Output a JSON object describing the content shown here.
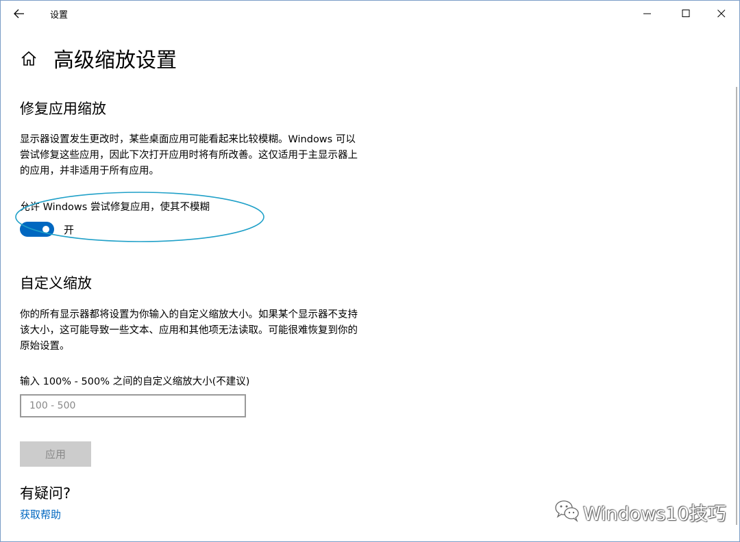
{
  "window": {
    "title": "设置"
  },
  "page": {
    "title": "高级缩放设置"
  },
  "fix_apps": {
    "heading": "修复应用缩放",
    "description": "显示器设置发生更改时，某些桌面应用可能看起来比较模糊。Windows 可以尝试修复这些应用，因此下次打开应用时将有所改善。这仅适用于主显示器上的应用，并非适用于所有应用。",
    "toggle_label": "允许 Windows 尝试修复应用，使其不模糊",
    "toggle_state": "开",
    "toggle_on": true
  },
  "custom_scaling": {
    "heading": "自定义缩放",
    "description": "你的所有显示器都将设置为你输入的自定义缩放大小。如果某个显示器不支持该大小，这可能导致一些文本、应用和其他项无法读取。可能很难恢复到你的原始设置。",
    "input_label": "输入 100% - 500% 之间的自定义缩放大小(不建议)",
    "input_value": "",
    "input_placeholder": "100 - 500",
    "apply_label": "应用"
  },
  "help": {
    "heading": "有疑问?",
    "link": "获取帮助"
  },
  "watermark": {
    "text": "Windows10技巧",
    "icon": "wechat-icon"
  },
  "icons": {
    "back": "back-arrow-icon",
    "home": "home-icon",
    "minimize": "minimize-icon",
    "maximize": "maximize-icon",
    "close": "close-icon"
  },
  "colors": {
    "accent": "#0067c0",
    "annotation": "#1fa0c8",
    "disabled_button": "#cccccc"
  }
}
